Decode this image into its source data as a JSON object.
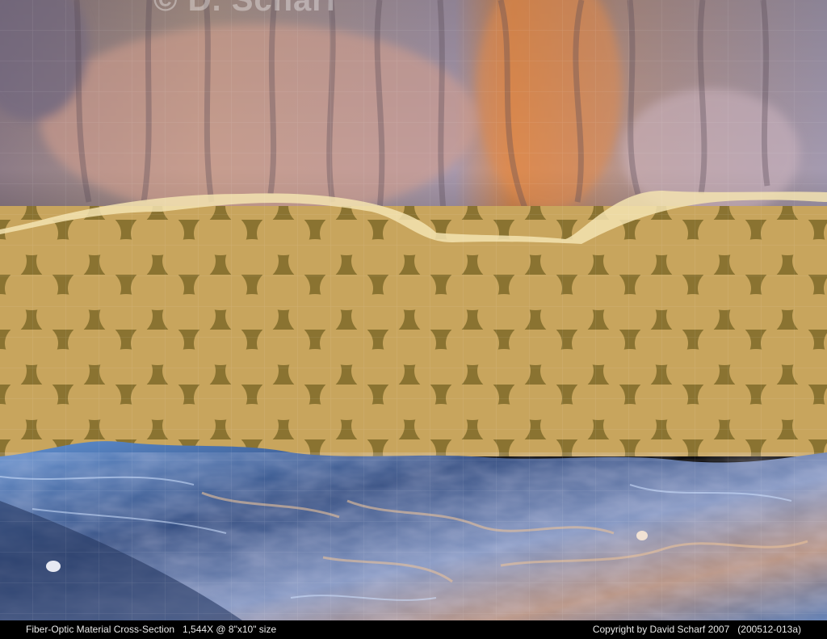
{
  "image": {
    "subject": "scanning electron micrograph of a fiber-optic material cross-section",
    "palette": {
      "top_layer_violet": "#9c8ca8",
      "top_layer_orange": "#d7905a",
      "honeycomb_fill": "#c9a760",
      "honeycomb_walls": "#7d6a2c",
      "fractured_base_blue": "#6f9ed8",
      "fractured_base_shadow": "#253760",
      "fracture_highlight": "#e9c29a"
    }
  },
  "watermark": {
    "text": "© D. Scharf"
  },
  "caption": {
    "left": "Fiber-Optic Material Cross-Section   1,544X @ 8\"x10\" size",
    "right": "Copyright by David Scharf 2007   (200512-013a)"
  }
}
